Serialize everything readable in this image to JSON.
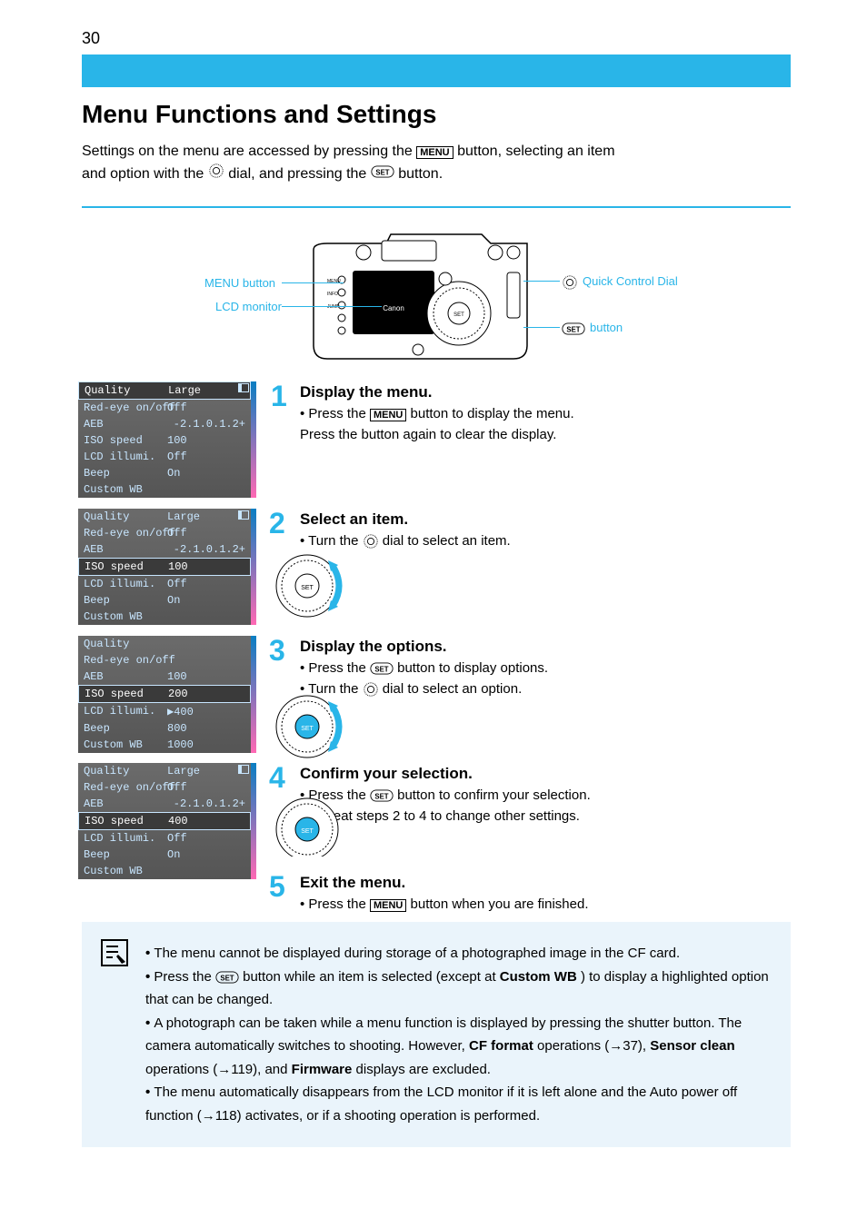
{
  "page_number": "30",
  "title": "Menu Functions and Settings",
  "intro": {
    "line1_a": "Settings on the menu are accessed by pressing the",
    "line1_b": " button, selecting an item",
    "line2_a": "and option with the ",
    "line2_b": " dial, and pressing the ",
    "line2_c": " button.",
    "menu_label": "MENU"
  },
  "labels": {
    "menu_button": "MENU button",
    "lcd_monitor": "LCD monitor",
    "quick_dial": "Quick Control Dial",
    "set_button": " button"
  },
  "steps": {
    "s1": {
      "num": "1",
      "title": "Display the menu.",
      "body_a": "• Press the ",
      "body_b": " button to display the menu.",
      "body_c": "Press the button again to clear the display.",
      "menu_label": "MENU"
    },
    "s2": {
      "num": "2",
      "title": "Select an item.",
      "body_a": "• Turn the ",
      "body_b": " dial to select an item."
    },
    "s3": {
      "num": "3",
      "title": "Display the options.",
      "body_a": "• Press the ",
      "body_b": " button to display options.",
      "body2_a": "• Turn the ",
      "body2_b": " dial to select an option."
    },
    "s4": {
      "num": "4",
      "title": "Confirm your selection.",
      "body_a": "• Press the ",
      "body_b": " button to confirm your selection.",
      "body2": "• Repeat steps 2 to 4 to change other settings."
    },
    "s5": {
      "num": "5",
      "title": "Exit the menu.",
      "body_a": "• Press the ",
      "body_b": " button when you are finished.",
      "menu_label": "MENU"
    }
  },
  "menus": {
    "m1": [
      {
        "k": "Quality",
        "v": "Large",
        "hl": true
      },
      {
        "k": "Red-eye on/off",
        "v": "Off"
      },
      {
        "k": "AEB",
        "v": "-2.1.0.1.2+"
      },
      {
        "k": "ISO speed",
        "v": "100"
      },
      {
        "k": "LCD illumi.",
        "v": "Off"
      },
      {
        "k": "Beep",
        "v": "On"
      },
      {
        "k": "Custom WB",
        "v": ""
      }
    ],
    "m2": [
      {
        "k": "Quality",
        "v": "Large"
      },
      {
        "k": "Red-eye on/off",
        "v": "Off"
      },
      {
        "k": "AEB",
        "v": "-2.1.0.1.2+"
      },
      {
        "k": "ISO speed",
        "v": "100",
        "hl": true
      },
      {
        "k": "LCD illumi.",
        "v": "Off"
      },
      {
        "k": "Beep",
        "v": "On"
      },
      {
        "k": "Custom WB",
        "v": ""
      }
    ],
    "m3": [
      {
        "k": "Quality",
        "v": ""
      },
      {
        "k": "Red-eye on/off",
        "v": ""
      },
      {
        "k": "AEB",
        "v": "100"
      },
      {
        "k": "ISO speed",
        "v": "200",
        "hl": true
      },
      {
        "k": "LCD illumi.",
        "v": "▶400"
      },
      {
        "k": "Beep",
        "v": "800"
      },
      {
        "k": "Custom WB",
        "v": "1000"
      }
    ],
    "m4": [
      {
        "k": "Quality",
        "v": "Large"
      },
      {
        "k": "Red-eye on/off",
        "v": "Off"
      },
      {
        "k": "AEB",
        "v": "-2.1.0.1.2+"
      },
      {
        "k": "ISO speed",
        "v": "400",
        "hl": true
      },
      {
        "k": "LCD illumi.",
        "v": "Off"
      },
      {
        "k": "Beep",
        "v": "On"
      },
      {
        "k": "Custom WB",
        "v": ""
      }
    ]
  },
  "notes": {
    "n1": "The menu cannot be displayed during storage of a photographed image in the CF card.",
    "n2_a": "Press the ",
    "n2_b": " button while an item is selected (except at ",
    "n2_c": "Custom WB",
    "n2_d": ") to display a highlighted option that can be changed.",
    "n3_a": "A photograph can be taken while a menu function is displayed by pressing the shutter button. The camera automatically switches to shooting. However, ",
    "n3_b": "CF format",
    "n3_c": " operations (→37), ",
    "n3_d": "Sensor clean",
    "n3_e": " operations (→119), and ",
    "n3_f": "Firmware",
    "n3_g": " displays are excluded.",
    "n4": "The menu automatically disappears from the LCD monitor if it is left alone and the Auto power off function (→118) activates, or if a shooting operation is performed."
  }
}
